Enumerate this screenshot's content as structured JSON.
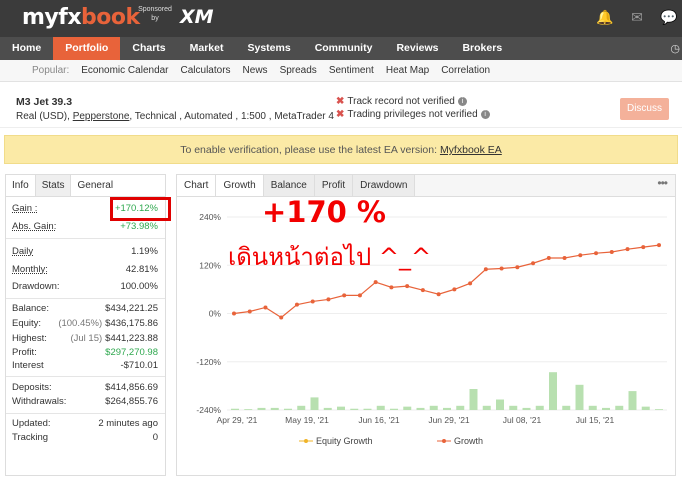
{
  "header": {
    "logo_main": "myfx",
    "logo_accent": "book",
    "sponsor_text": "Sponsored by",
    "sponsor_brand": "XM",
    "icons": [
      "bell-icon",
      "mail-icon",
      "chat-icon"
    ]
  },
  "nav": {
    "items": [
      "Home",
      "Portfolio",
      "Charts",
      "Market",
      "Systems",
      "Community",
      "Reviews",
      "Brokers"
    ],
    "active": "Portfolio",
    "clock_icon": "clock-icon"
  },
  "subnav": {
    "label": "Popular:",
    "items": [
      "Economic Calendar",
      "Calculators",
      "News",
      "Spreads",
      "Sentiment",
      "Heat Map",
      "Correlation"
    ]
  },
  "system": {
    "name": "M3 Jet 39.3",
    "desc_prefix": "Real (USD),",
    "broker": "Pepperstone",
    "desc_suffix": ", Technical , Automated , 1:500 , MetaTrader 4",
    "verify1": "Track record not verified",
    "verify2": "Trading privileges not verified",
    "discuss": "Discuss"
  },
  "banner": {
    "text": "To enable verification, please use the latest EA version:",
    "link": "Myfxbook EA"
  },
  "left_tabs": [
    "Info",
    "Stats",
    "General"
  ],
  "stats": {
    "gain_label": "Gain :",
    "gain_value": "+170.12%",
    "abs_gain_label": "Abs. Gain:",
    "abs_gain_value": "+73.98%",
    "daily_label": "Daily",
    "daily_value": "1.19%",
    "monthly_label": "Monthly:",
    "monthly_value": "42.81%",
    "drawdown_label": "Drawdown:",
    "drawdown_value": "100.00%",
    "balance_label": "Balance:",
    "balance_value": "$434,221.25",
    "equity_label": "Equity:",
    "equity_pct": "(100.45%)",
    "equity_value": "$436,175.86",
    "highest_label": "Highest:",
    "highest_date": "(Jul 15)",
    "highest_value": "$441,223.88",
    "profit_label": "Profit:",
    "profit_value": "$297,270.98",
    "interest_label": "Interest",
    "interest_value": "-$710.01",
    "deposits_label": "Deposits:",
    "deposits_value": "$414,856.69",
    "withdrawals_label": "Withdrawals:",
    "withdrawals_value": "$264,855.76",
    "updated_label": "Updated:",
    "updated_value": "2 minutes ago",
    "tracking_label": "Tracking",
    "tracking_value": "0"
  },
  "right_tabs": [
    "Chart",
    "Growth",
    "Balance",
    "Profit",
    "Drawdown"
  ],
  "annotation": {
    "line1": "+170 %",
    "line2": "เดินหน้าต่อไป ^_^"
  },
  "chart_data": {
    "type": "line",
    "yticks": [
      "240%",
      "120%",
      "0%",
      "-120%",
      "-240%"
    ],
    "ylim": [
      -240,
      240
    ],
    "xticks": [
      "Apr 29, '21",
      "May 19, '21",
      "Jun 16, '21",
      "Jun 29, '21",
      "Jul 08, '21",
      "Jul 15, '21"
    ],
    "legend": [
      "Equity Growth",
      "Growth"
    ],
    "legend_placement": "bottom",
    "colors": {
      "equity": "#f0b429",
      "growth": "#e8633a",
      "bars": "#b8e0b0"
    },
    "series": [
      {
        "name": "Growth",
        "values": [
          0,
          5,
          15,
          -10,
          22,
          30,
          35,
          45,
          45,
          78,
          65,
          68,
          58,
          48,
          60,
          75,
          110,
          112,
          115,
          125,
          138,
          138,
          145,
          150,
          153,
          160,
          165,
          170
        ]
      },
      {
        "name": "Equity Growth",
        "values": []
      }
    ],
    "bars": [
      3,
      2,
      5,
      5,
      3,
      10,
      30,
      5,
      8,
      3,
      3,
      10,
      3,
      8,
      5,
      10,
      5,
      10,
      50,
      10,
      25,
      10,
      5,
      10,
      90,
      10,
      60,
      10,
      5,
      10,
      45,
      8,
      2
    ]
  }
}
